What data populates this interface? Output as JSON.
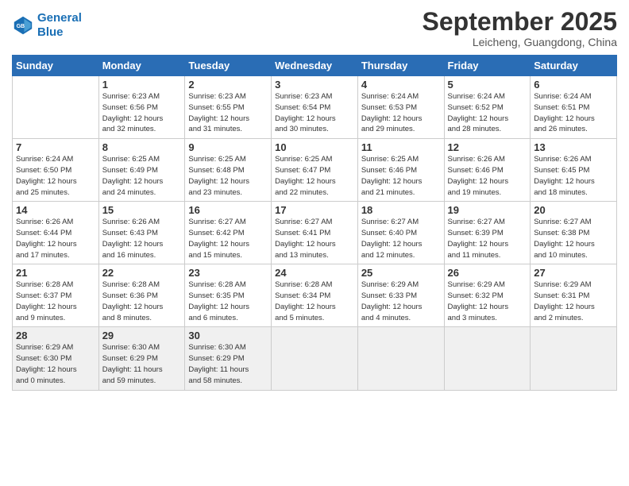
{
  "header": {
    "logo_line1": "General",
    "logo_line2": "Blue",
    "month": "September 2025",
    "location": "Leicheng, Guangdong, China"
  },
  "weekdays": [
    "Sunday",
    "Monday",
    "Tuesday",
    "Wednesday",
    "Thursday",
    "Friday",
    "Saturday"
  ],
  "weeks": [
    [
      {
        "day": "",
        "info": ""
      },
      {
        "day": "1",
        "info": "Sunrise: 6:23 AM\nSunset: 6:56 PM\nDaylight: 12 hours\nand 32 minutes."
      },
      {
        "day": "2",
        "info": "Sunrise: 6:23 AM\nSunset: 6:55 PM\nDaylight: 12 hours\nand 31 minutes."
      },
      {
        "day": "3",
        "info": "Sunrise: 6:23 AM\nSunset: 6:54 PM\nDaylight: 12 hours\nand 30 minutes."
      },
      {
        "day": "4",
        "info": "Sunrise: 6:24 AM\nSunset: 6:53 PM\nDaylight: 12 hours\nand 29 minutes."
      },
      {
        "day": "5",
        "info": "Sunrise: 6:24 AM\nSunset: 6:52 PM\nDaylight: 12 hours\nand 28 minutes."
      },
      {
        "day": "6",
        "info": "Sunrise: 6:24 AM\nSunset: 6:51 PM\nDaylight: 12 hours\nand 26 minutes."
      }
    ],
    [
      {
        "day": "7",
        "info": "Sunrise: 6:24 AM\nSunset: 6:50 PM\nDaylight: 12 hours\nand 25 minutes."
      },
      {
        "day": "8",
        "info": "Sunrise: 6:25 AM\nSunset: 6:49 PM\nDaylight: 12 hours\nand 24 minutes."
      },
      {
        "day": "9",
        "info": "Sunrise: 6:25 AM\nSunset: 6:48 PM\nDaylight: 12 hours\nand 23 minutes."
      },
      {
        "day": "10",
        "info": "Sunrise: 6:25 AM\nSunset: 6:47 PM\nDaylight: 12 hours\nand 22 minutes."
      },
      {
        "day": "11",
        "info": "Sunrise: 6:25 AM\nSunset: 6:46 PM\nDaylight: 12 hours\nand 21 minutes."
      },
      {
        "day": "12",
        "info": "Sunrise: 6:26 AM\nSunset: 6:46 PM\nDaylight: 12 hours\nand 19 minutes."
      },
      {
        "day": "13",
        "info": "Sunrise: 6:26 AM\nSunset: 6:45 PM\nDaylight: 12 hours\nand 18 minutes."
      }
    ],
    [
      {
        "day": "14",
        "info": "Sunrise: 6:26 AM\nSunset: 6:44 PM\nDaylight: 12 hours\nand 17 minutes."
      },
      {
        "day": "15",
        "info": "Sunrise: 6:26 AM\nSunset: 6:43 PM\nDaylight: 12 hours\nand 16 minutes."
      },
      {
        "day": "16",
        "info": "Sunrise: 6:27 AM\nSunset: 6:42 PM\nDaylight: 12 hours\nand 15 minutes."
      },
      {
        "day": "17",
        "info": "Sunrise: 6:27 AM\nSunset: 6:41 PM\nDaylight: 12 hours\nand 13 minutes."
      },
      {
        "day": "18",
        "info": "Sunrise: 6:27 AM\nSunset: 6:40 PM\nDaylight: 12 hours\nand 12 minutes."
      },
      {
        "day": "19",
        "info": "Sunrise: 6:27 AM\nSunset: 6:39 PM\nDaylight: 12 hours\nand 11 minutes."
      },
      {
        "day": "20",
        "info": "Sunrise: 6:27 AM\nSunset: 6:38 PM\nDaylight: 12 hours\nand 10 minutes."
      }
    ],
    [
      {
        "day": "21",
        "info": "Sunrise: 6:28 AM\nSunset: 6:37 PM\nDaylight: 12 hours\nand 9 minutes."
      },
      {
        "day": "22",
        "info": "Sunrise: 6:28 AM\nSunset: 6:36 PM\nDaylight: 12 hours\nand 8 minutes."
      },
      {
        "day": "23",
        "info": "Sunrise: 6:28 AM\nSunset: 6:35 PM\nDaylight: 12 hours\nand 6 minutes."
      },
      {
        "day": "24",
        "info": "Sunrise: 6:28 AM\nSunset: 6:34 PM\nDaylight: 12 hours\nand 5 minutes."
      },
      {
        "day": "25",
        "info": "Sunrise: 6:29 AM\nSunset: 6:33 PM\nDaylight: 12 hours\nand 4 minutes."
      },
      {
        "day": "26",
        "info": "Sunrise: 6:29 AM\nSunset: 6:32 PM\nDaylight: 12 hours\nand 3 minutes."
      },
      {
        "day": "27",
        "info": "Sunrise: 6:29 AM\nSunset: 6:31 PM\nDaylight: 12 hours\nand 2 minutes."
      }
    ],
    [
      {
        "day": "28",
        "info": "Sunrise: 6:29 AM\nSunset: 6:30 PM\nDaylight: 12 hours\nand 0 minutes."
      },
      {
        "day": "29",
        "info": "Sunrise: 6:30 AM\nSunset: 6:29 PM\nDaylight: 11 hours\nand 59 minutes."
      },
      {
        "day": "30",
        "info": "Sunrise: 6:30 AM\nSunset: 6:29 PM\nDaylight: 11 hours\nand 58 minutes."
      },
      {
        "day": "",
        "info": ""
      },
      {
        "day": "",
        "info": ""
      },
      {
        "day": "",
        "info": ""
      },
      {
        "day": "",
        "info": ""
      }
    ]
  ]
}
